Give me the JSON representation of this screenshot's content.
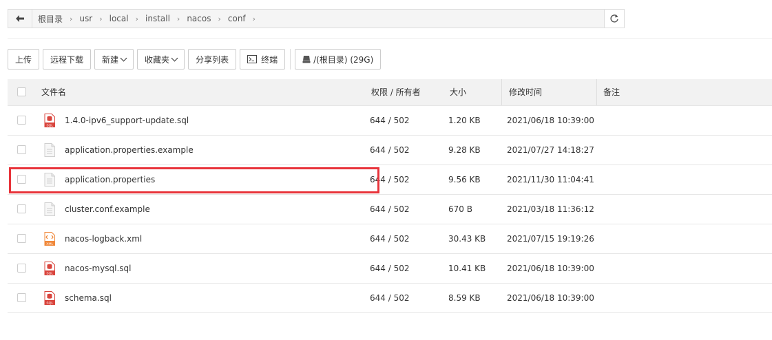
{
  "breadcrumb": [
    "根目录",
    "usr",
    "local",
    "install",
    "nacos",
    "conf"
  ],
  "toolbar": {
    "upload": "上传",
    "remote_download": "远程下载",
    "new": "新建",
    "favorites": "收藏夹",
    "share_list": "分享列表",
    "terminal": "终端",
    "disk": "/(根目录) (29G)"
  },
  "table": {
    "headers": {
      "name": "文件名",
      "perm": "权限 / 所有者",
      "size": "大小",
      "mtime": "修改时间",
      "note": "备注"
    },
    "rows": [
      {
        "icon": "sql-file-icon",
        "name": "1.4.0-ipv6_support-update.sql",
        "perm": "644 / 502",
        "size": "1.20 KB",
        "mtime": "2021/06/18 10:39:00"
      },
      {
        "icon": "text-file-icon",
        "name": "application.properties.example",
        "perm": "644 / 502",
        "size": "9.28 KB",
        "mtime": "2021/07/27 14:18:27"
      },
      {
        "icon": "text-file-icon",
        "name": "application.properties",
        "perm": "644 / 502",
        "size": "9.56 KB",
        "mtime": "2021/11/30 11:04:41"
      },
      {
        "icon": "text-file-icon",
        "name": "cluster.conf.example",
        "perm": "644 / 502",
        "size": "670 B",
        "mtime": "2021/03/18 11:36:12"
      },
      {
        "icon": "xml-file-icon",
        "name": "nacos-logback.xml",
        "perm": "644 / 502",
        "size": "30.43 KB",
        "mtime": "2021/07/15 19:19:26"
      },
      {
        "icon": "sql-file-icon",
        "name": "nacos-mysql.sql",
        "perm": "644 / 502",
        "size": "10.41 KB",
        "mtime": "2021/06/18 10:39:00"
      },
      {
        "icon": "sql-file-icon",
        "name": "schema.sql",
        "perm": "644 / 502",
        "size": "8.59 KB",
        "mtime": "2021/06/18 10:39:00"
      }
    ]
  },
  "icon_labels": {
    "sql": "SQL",
    "xml": "XML"
  },
  "colors": {
    "highlight": "#e8333a",
    "sql_icon": "#d9453d",
    "xml_icon": "#f0883a",
    "text_icon": "#cfcfcf"
  }
}
